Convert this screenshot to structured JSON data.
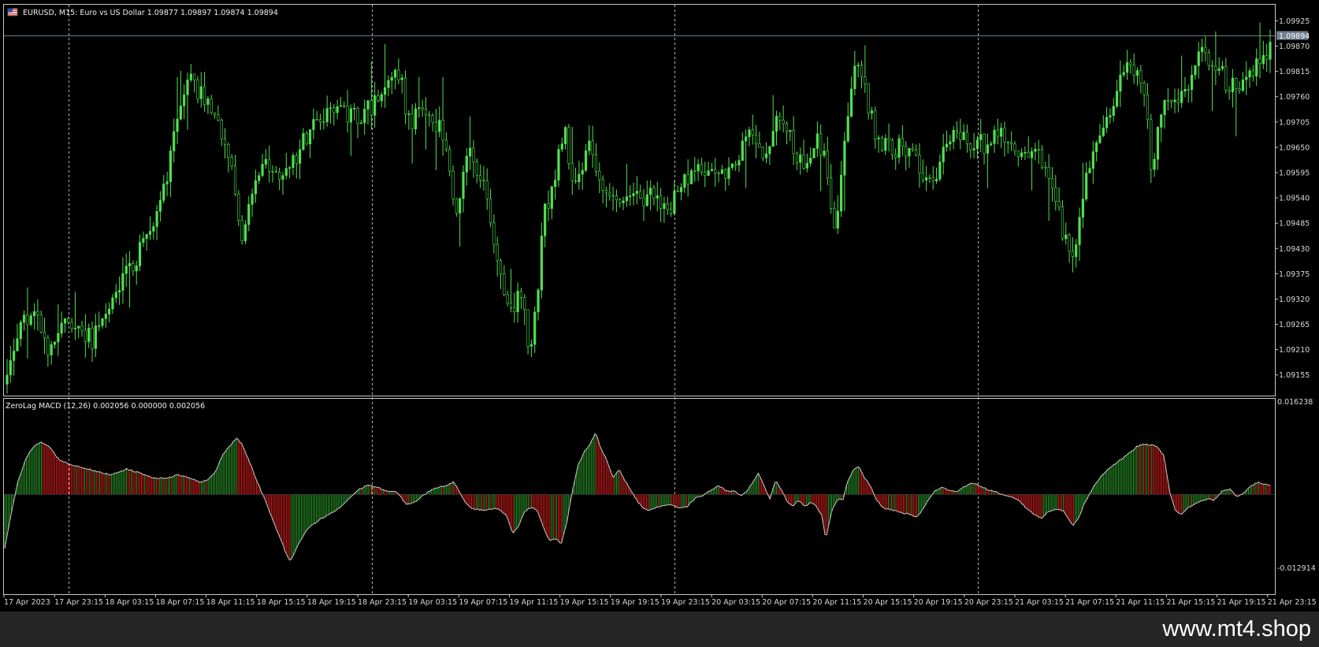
{
  "colors": {
    "background": "#000000",
    "frame": "#c8c8c8",
    "candle_bull": "#4fe14f",
    "candle_bear": "#32c832",
    "hist_up": "#2fa52f",
    "hist_down": "#e62020",
    "macd_line": "#c8c8c8",
    "grid": "#d0d0d0",
    "price_line": "#6e7c8c",
    "price_tag_bg": "#707e8c",
    "footer": "#262626",
    "watermark": "#ffffff"
  },
  "main_title": "EURUSD, M15:  Euro vs US Dollar  1.09877 1.09897 1.09874 1.09894",
  "flag_icon": "eu-us-flag-icon",
  "current_price_label": "1.09894",
  "sub_title": "ZeroLag MACD (12,26) 0.002056 0.000000 0.002056",
  "watermark": "www.mt4.shop",
  "chart_data": [
    {
      "type": "candlestick",
      "title": "EURUSD, M15:  Euro vs US Dollar  1.09877 1.09897 1.09874 1.09894",
      "symbol": "EURUSD",
      "timeframe": "M15",
      "last_ohlc": {
        "open": 1.09877,
        "high": 1.09897,
        "low": 1.09874,
        "close": 1.09894
      },
      "current_price": 1.09894,
      "ylim": [
        1.0911,
        1.0996
      ],
      "y_ticks": [
        1.09925,
        1.0987,
        1.09815,
        1.0976,
        1.09705,
        1.0965,
        1.09595,
        1.0954,
        1.09485,
        1.0943,
        1.09375,
        1.0932,
        1.09265,
        1.0921,
        1.09155
      ],
      "y_tick_labels": [
        "1.09925",
        "1.09870",
        "1.09815",
        "1.09760",
        "1.09705",
        "1.09650",
        "1.09595",
        "1.09540",
        "1.09485",
        "1.09430",
        "1.09375",
        "1.09320",
        "1.09265",
        "1.09210",
        "1.09155"
      ],
      "x_tick_labels": [
        "17 Apr 2023",
        "17 Apr 23:15",
        "18 Apr 03:15",
        "18 Apr 07:15",
        "18 Apr 11:15",
        "18 Apr 15:15",
        "18 Apr 19:15",
        "18 Apr 23:15",
        "19 Apr 03:15",
        "19 Apr 07:15",
        "19 Apr 11:15",
        "19 Apr 15:15",
        "19 Apr 19:15",
        "19 Apr 23:15",
        "20 Apr 03:15",
        "20 Apr 07:15",
        "20 Apr 11:15",
        "20 Apr 15:15",
        "20 Apr 19:15",
        "20 Apr 23:15",
        "21 Apr 03:15",
        "21 Apr 07:15",
        "21 Apr 11:15",
        "21 Apr 15:15",
        "21 Apr 19:15",
        "21 Apr 23:15"
      ],
      "period_separators": [
        1,
        7,
        13,
        19
      ],
      "close_anchors": [
        [
          0,
          1.0914
        ],
        [
          4,
          1.0922
        ],
        [
          12,
          1.0928
        ],
        [
          18,
          1.0927
        ],
        [
          25,
          1.0921
        ],
        [
          35,
          1.0928
        ],
        [
          50,
          1.0923
        ],
        [
          65,
          1.0935
        ],
        [
          75,
          1.094
        ],
        [
          90,
          1.095
        ],
        [
          100,
          1.097
        ],
        [
          108,
          1.098
        ],
        [
          116,
          1.0976
        ],
        [
          124,
          1.097
        ],
        [
          132,
          1.0962
        ],
        [
          140,
          1.0945
        ],
        [
          150,
          1.0962
        ],
        [
          160,
          1.096
        ],
        [
          170,
          1.0962
        ],
        [
          180,
          1.0969
        ],
        [
          190,
          1.0972
        ],
        [
          200,
          1.0972
        ],
        [
          210,
          1.0972
        ],
        [
          220,
          1.0975
        ],
        [
          232,
          1.0982
        ],
        [
          238,
          1.097
        ],
        [
          248,
          1.0974
        ],
        [
          258,
          1.0968
        ],
        [
          266,
          1.095
        ],
        [
          274,
          1.0965
        ],
        [
          284,
          1.0955
        ],
        [
          290,
          1.094
        ],
        [
          298,
          1.0928
        ],
        [
          304,
          1.0935
        ],
        [
          310,
          1.0918
        ],
        [
          318,
          1.095
        ],
        [
          326,
          1.0962
        ],
        [
          330,
          1.097
        ],
        [
          336,
          1.0955
        ],
        [
          344,
          1.0965
        ],
        [
          352,
          1.0958
        ],
        [
          360,
          1.0955
        ],
        [
          372,
          1.0954
        ],
        [
          382,
          1.0955
        ],
        [
          390,
          1.095
        ],
        [
          400,
          1.0957
        ],
        [
          410,
          1.096
        ],
        [
          420,
          1.0958
        ],
        [
          430,
          1.0961
        ],
        [
          440,
          1.0967
        ],
        [
          448,
          1.0962
        ],
        [
          456,
          1.097
        ],
        [
          464,
          1.0967
        ],
        [
          472,
          1.096
        ],
        [
          480,
          1.0966
        ],
        [
          486,
          1.096
        ],
        [
          490,
          1.0945
        ],
        [
          496,
          1.0967
        ],
        [
          502,
          1.0983
        ],
        [
          508,
          1.0978
        ],
        [
          514,
          1.0968
        ],
        [
          522,
          1.0965
        ],
        [
          532,
          1.0965
        ],
        [
          540,
          1.096
        ],
        [
          548,
          1.0958
        ],
        [
          556,
          1.0965
        ],
        [
          564,
          1.0968
        ],
        [
          572,
          1.0965
        ],
        [
          580,
          1.0966
        ],
        [
          588,
          1.097
        ],
        [
          596,
          1.0965
        ],
        [
          604,
          1.0965
        ],
        [
          612,
          1.0962
        ],
        [
          620,
          1.0955
        ],
        [
          626,
          1.0945
        ],
        [
          632,
          1.0942
        ],
        [
          638,
          1.0958
        ],
        [
          646,
          1.0968
        ],
        [
          652,
          1.0972
        ],
        [
          660,
          1.098
        ],
        [
          668,
          1.0983
        ],
        [
          674,
          1.0975
        ],
        [
          678,
          1.096
        ],
        [
          684,
          1.0974
        ],
        [
          692,
          1.0976
        ],
        [
          700,
          1.098
        ],
        [
          708,
          1.0985
        ],
        [
          716,
          1.0983
        ],
        [
          724,
          1.0978
        ],
        [
          732,
          1.0979
        ],
        [
          740,
          1.0983
        ],
        [
          748,
          1.0987
        ]
      ]
    },
    {
      "type": "histogram+line",
      "title": "ZeroLag MACD (12,26) 0.002056 0.000000 0.002056",
      "indicator": "ZeroLag MACD",
      "params": [
        12,
        26
      ],
      "readout": {
        "value1": 0.002056,
        "value2": 0.0,
        "value3": 0.002056
      },
      "ylim": [
        -0.012914,
        0.016238
      ],
      "y_tick_labels": [
        "0.016238",
        "-0.012914"
      ],
      "y_ticks": [
        0.016238,
        -0.012914
      ],
      "zero_line": 0,
      "value_anchors": [
        [
          0,
          -0.0095
        ],
        [
          6,
          -0.004
        ],
        [
          14,
          0.0025
        ],
        [
          22,
          0.0065
        ],
        [
          30,
          0.0085
        ],
        [
          38,
          0.0092
        ],
        [
          46,
          0.0085
        ],
        [
          56,
          0.0062
        ],
        [
          66,
          0.0054
        ],
        [
          80,
          0.0048
        ],
        [
          96,
          0.004
        ],
        [
          110,
          0.0035
        ],
        [
          126,
          0.0045
        ],
        [
          140,
          0.0038
        ],
        [
          152,
          0.003
        ],
        [
          168,
          0.0028
        ],
        [
          178,
          0.0035
        ],
        [
          190,
          0.003
        ],
        [
          202,
          0.0022
        ],
        [
          210,
          0.0025
        ],
        [
          218,
          0.004
        ],
        [
          226,
          0.0072
        ],
        [
          236,
          0.0092
        ],
        [
          240,
          0.01
        ],
        [
          246,
          0.0088
        ],
        [
          254,
          0.0055
        ],
        [
          262,
          0.002
        ],
        [
          270,
          -0.0012
        ],
        [
          278,
          -0.0048
        ],
        [
          286,
          -0.008
        ],
        [
          292,
          -0.0108
        ],
        [
          296,
          -0.0118
        ],
        [
          304,
          -0.0088
        ],
        [
          314,
          -0.006
        ],
        [
          326,
          -0.0045
        ],
        [
          336,
          -0.0035
        ],
        [
          346,
          -0.0025
        ],
        [
          356,
          -0.0008
        ],
        [
          366,
          0.0008
        ],
        [
          376,
          0.0017
        ],
        [
          386,
          0.0012
        ],
        [
          396,
          0.0006
        ],
        [
          406,
          0.0004
        ],
        [
          416,
          -0.0018
        ],
        [
          426,
          -0.0012
        ],
        [
          436,
          0.0002
        ],
        [
          446,
          0.0012
        ],
        [
          456,
          0.0015
        ],
        [
          464,
          0.0022
        ],
        [
          470,
          0.0008
        ],
        [
          476,
          -0.0012
        ],
        [
          484,
          -0.0025
        ],
        [
          496,
          -0.0028
        ],
        [
          506,
          -0.0025
        ],
        [
          514,
          -0.0028
        ],
        [
          520,
          -0.004
        ],
        [
          526,
          -0.007
        ],
        [
          532,
          -0.0055
        ],
        [
          538,
          -0.003
        ],
        [
          546,
          -0.0022
        ],
        [
          552,
          -0.003
        ],
        [
          558,
          -0.006
        ],
        [
          564,
          -0.0082
        ],
        [
          570,
          -0.0078
        ],
        [
          576,
          -0.0088
        ],
        [
          582,
          -0.005
        ],
        [
          588,
          0.001
        ],
        [
          594,
          0.0055
        ],
        [
          600,
          0.0075
        ],
        [
          606,
          0.009
        ],
        [
          612,
          0.011
        ],
        [
          616,
          0.0085
        ],
        [
          622,
          0.0065
        ],
        [
          630,
          0.003
        ],
        [
          636,
          0.0045
        ],
        [
          642,
          0.0025
        ],
        [
          648,
          0.0008
        ],
        [
          656,
          -0.0015
        ],
        [
          664,
          -0.0028
        ],
        [
          672,
          -0.0025
        ],
        [
          680,
          -0.002
        ],
        [
          690,
          -0.0018
        ],
        [
          698,
          -0.0025
        ],
        [
          706,
          -0.0022
        ],
        [
          714,
          -0.0008
        ],
        [
          722,
          -0.0002
        ],
        [
          730,
          0.0006
        ],
        [
          738,
          0.0015
        ],
        [
          746,
          0.0008
        ],
        [
          756,
          0.0005
        ],
        [
          762,
          -0.0002
        ],
        [
          768,
          0.0006
        ],
        [
          774,
          0.002
        ],
        [
          780,
          0.0038
        ],
        [
          786,
          0.0015
        ],
        [
          792,
          -0.0008
        ],
        [
          798,
          0.0025
        ],
        [
          804,
          0.0008
        ],
        [
          810,
          -0.0012
        ],
        [
          816,
          -0.002
        ],
        [
          822,
          -0.001
        ],
        [
          828,
          -0.0022
        ],
        [
          834,
          -0.0015
        ],
        [
          840,
          -0.002
        ],
        [
          846,
          -0.0038
        ],
        [
          850,
          -0.0078
        ],
        [
          856,
          -0.003
        ],
        [
          862,
          -0.0008
        ],
        [
          868,
          -0.001
        ],
        [
          872,
          0.002
        ],
        [
          878,
          0.0042
        ],
        [
          884,
          0.005
        ],
        [
          890,
          0.003
        ],
        [
          896,
          0.0015
        ],
        [
          902,
          -0.0008
        ],
        [
          910,
          -0.0025
        ],
        [
          920,
          -0.0028
        ],
        [
          928,
          -0.0032
        ],
        [
          936,
          -0.0035
        ],
        [
          944,
          -0.004
        ],
        [
          950,
          -0.0028
        ],
        [
          956,
          -0.001
        ],
        [
          962,
          0.0005
        ],
        [
          970,
          0.0012
        ],
        [
          978,
          0.0008
        ],
        [
          986,
          0.0005
        ],
        [
          994,
          0.0015
        ],
        [
          1002,
          0.002
        ],
        [
          1010,
          0.0015
        ],
        [
          1018,
          0.0008
        ],
        [
          1026,
          0.0005
        ],
        [
          1034,
          -0.0002
        ],
        [
          1042,
          -0.0005
        ],
        [
          1050,
          -0.001
        ],
        [
          1056,
          -0.0022
        ],
        [
          1062,
          -0.003
        ],
        [
          1068,
          -0.0038
        ],
        [
          1074,
          -0.0042
        ],
        [
          1080,
          -0.003
        ],
        [
          1090,
          -0.0025
        ],
        [
          1096,
          -0.003
        ],
        [
          1102,
          -0.0045
        ],
        [
          1106,
          -0.0055
        ],
        [
          1112,
          -0.004
        ],
        [
          1118,
          -0.0015
        ],
        [
          1126,
          0.001
        ],
        [
          1134,
          0.003
        ],
        [
          1142,
          0.0045
        ],
        [
          1150,
          0.0055
        ],
        [
          1158,
          0.0065
        ],
        [
          1166,
          0.0075
        ],
        [
          1172,
          0.0085
        ],
        [
          1178,
          0.0088
        ],
        [
          1186,
          0.0088
        ],
        [
          1192,
          0.0085
        ],
        [
          1200,
          0.007
        ],
        [
          1206,
          0.0005
        ],
        [
          1212,
          -0.003
        ],
        [
          1218,
          -0.0035
        ],
        [
          1226,
          -0.0022
        ],
        [
          1234,
          -0.0016
        ],
        [
          1244,
          -0.0008
        ],
        [
          1252,
          -0.001
        ],
        [
          1260,
          0.0005
        ],
        [
          1268,
          0.001
        ],
        [
          1276,
          -0.0005
        ],
        [
          1284,
          0.0005
        ],
        [
          1290,
          0.0015
        ],
        [
          1298,
          0.0022
        ],
        [
          1304,
          0.0018
        ],
        [
          1310,
          0.0015
        ]
      ]
    }
  ]
}
